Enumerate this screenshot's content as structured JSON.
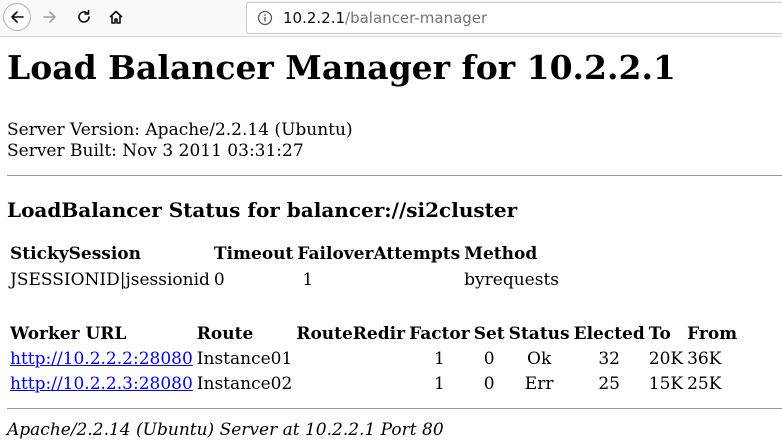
{
  "browser": {
    "url_host": "10.2.2.1",
    "url_path": "/balancer-manager",
    "icons": [
      "back-icon",
      "forward-icon",
      "reload-icon",
      "home-icon",
      "info-icon"
    ]
  },
  "page": {
    "title": "Load Balancer Manager for 10.2.2.1",
    "server_version": "Server Version: Apache/2.2.14 (Ubuntu)",
    "server_built": "Server Built: Nov 3 2011 03:31:27",
    "status_heading": "LoadBalancer Status for balancer://si2cluster",
    "status_table": {
      "headers": [
        "StickySession",
        "Timeout",
        "FailoverAttempts",
        "Method"
      ],
      "row": [
        "JSESSIONID|jsessionid",
        "0",
        "1",
        "byrequests"
      ]
    },
    "workers_table": {
      "headers": [
        "Worker URL",
        "Route",
        "RouteRedir",
        "Factor",
        "Set",
        "Status",
        "Elected",
        "To",
        "From"
      ],
      "rows": [
        [
          "http://10.2.2.2:28080",
          "Instance01",
          "",
          "1",
          "0",
          "Ok",
          "32",
          "20K",
          "36K"
        ],
        [
          "http://10.2.2.3:28080",
          "Instance02",
          "",
          "1",
          "0",
          "Err",
          "25",
          "15K",
          "25K"
        ]
      ]
    },
    "footer": "Apache/2.2.14 (Ubuntu) Server at 10.2.2.1 Port 80"
  }
}
